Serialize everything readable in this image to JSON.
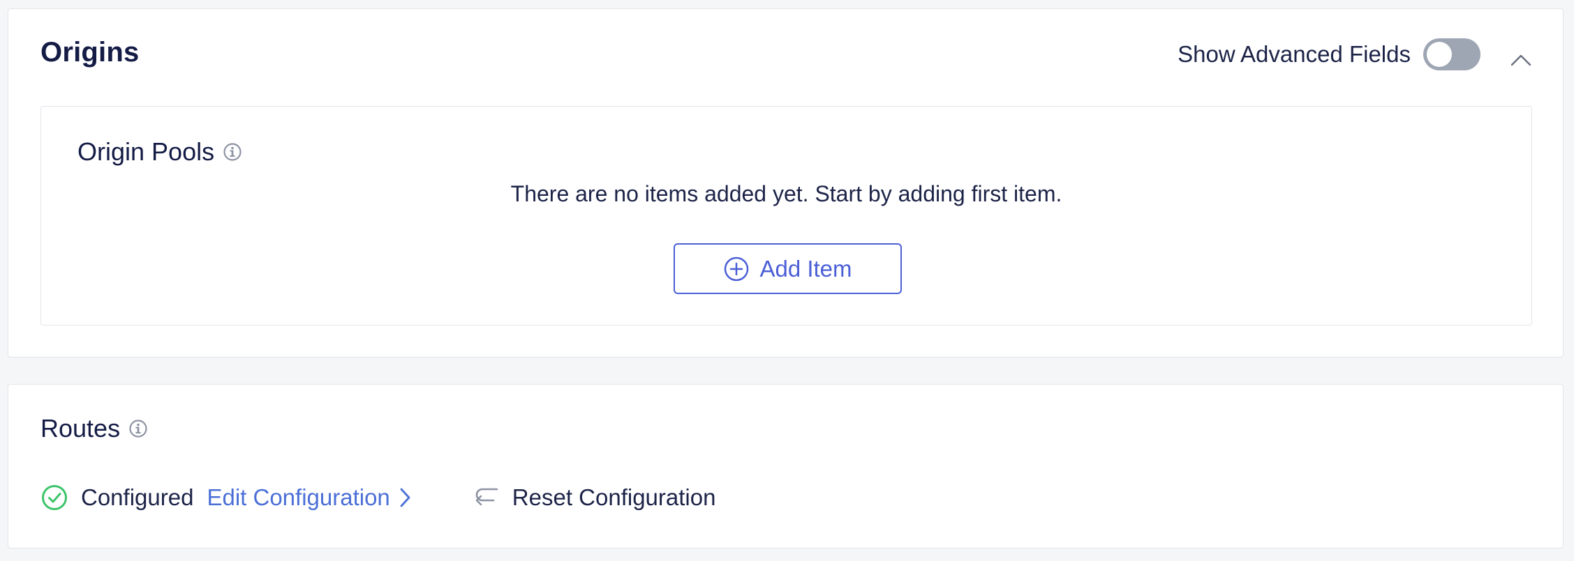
{
  "origins": {
    "title": "Origins",
    "advanced_fields_label": "Show Advanced Fields",
    "advanced_fields_enabled": false,
    "origin_pools": {
      "title": "Origin Pools",
      "empty_message": "There are no items added yet. Start by adding first item.",
      "add_button_label": "Add Item"
    }
  },
  "routes": {
    "title": "Routes",
    "status_label": "Configured",
    "edit_label": "Edit Configuration",
    "reset_label": "Reset Configuration"
  },
  "colors": {
    "accent": "#4b5fd6",
    "link": "#4b6fd6",
    "success": "#3cc46a",
    "toggle_off": "#9ea5b3",
    "text": "#1c2347"
  },
  "icons": {
    "info": "info-icon",
    "collapse": "chevron-up-icon",
    "add": "plus-circle-icon",
    "status": "check-circle-icon",
    "edit_arrow": "chevron-right-icon",
    "reset": "return-arrow-icon"
  }
}
